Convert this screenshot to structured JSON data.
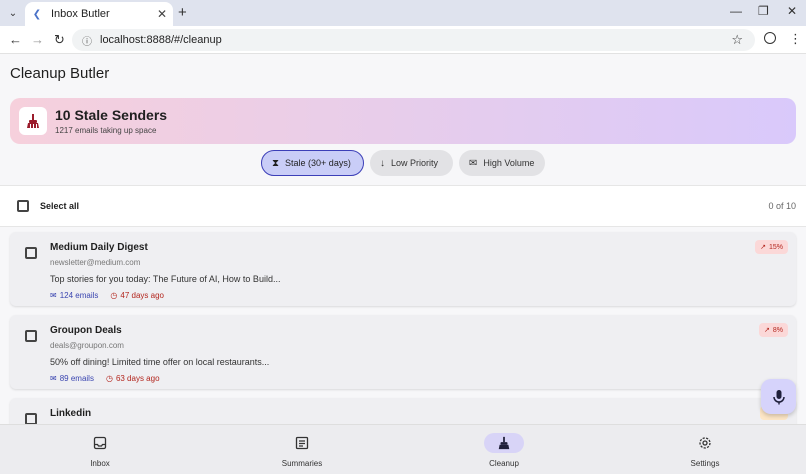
{
  "browser": {
    "tab_title": "Inbox Butler",
    "url": "localhost:8888/#/cleanup",
    "tab_close": "✕",
    "new_tab": "+"
  },
  "app": {
    "title": "Cleanup Butler"
  },
  "banner": {
    "title": "10 Stale Senders",
    "subtitle": "1217 emails taking up space",
    "icon": "broom-icon"
  },
  "filters": [
    {
      "label": "Stale (30+ days)",
      "icon": "hourglass-icon",
      "active": true
    },
    {
      "label": "Low Priority",
      "icon": "arrow-down-icon",
      "active": false
    },
    {
      "label": "High Volume",
      "icon": "mail-icon",
      "active": false
    }
  ],
  "select": {
    "label": "Select all",
    "count": "0 of 10"
  },
  "senders": [
    {
      "name": "Medium Daily Digest",
      "email": "newsletter@medium.com",
      "preview": "Top stories for you today: The Future of AI, How to Build...",
      "emails": "124 emails",
      "age": "47 days ago",
      "badge": "15%"
    },
    {
      "name": "Groupon Deals",
      "email": "deals@groupon.com",
      "preview": "50% off dining! Limited time offer on local restaurants...",
      "emails": "89 emails",
      "age": "63 days ago",
      "badge": "8%"
    },
    {
      "name": "Linkedin"
    }
  ],
  "nav": [
    {
      "label": "Inbox",
      "icon": "inbox-icon"
    },
    {
      "label": "Summaries",
      "icon": "summaries-icon"
    },
    {
      "label": "Cleanup",
      "icon": "broom-icon"
    },
    {
      "label": "Settings",
      "icon": "gear-icon"
    }
  ],
  "colors": {
    "accent": "#3c3fb8",
    "danger": "#b3261e",
    "fab": "#d6d3fb"
  }
}
